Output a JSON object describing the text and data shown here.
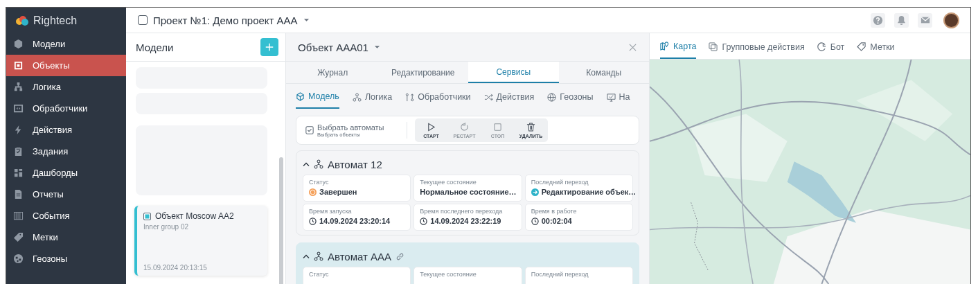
{
  "app": {
    "name": "Rightech"
  },
  "sidebar": {
    "items": [
      {
        "label": "Модели",
        "selected": false
      },
      {
        "label": "Объекты",
        "selected": true
      },
      {
        "label": "Логика",
        "selected": false
      },
      {
        "label": "Обработчики",
        "selected": false
      },
      {
        "label": "Действия",
        "selected": false
      },
      {
        "label": "Задания",
        "selected": false
      },
      {
        "label": "Дашборды",
        "selected": false
      },
      {
        "label": "Отчеты",
        "selected": false
      },
      {
        "label": "События",
        "selected": false
      },
      {
        "label": "Метки",
        "selected": false
      },
      {
        "label": "Геозоны",
        "selected": false
      }
    ]
  },
  "header": {
    "project": "Проект №1: Демо проект AAA"
  },
  "models": {
    "title": "Модели",
    "card": {
      "title": "Объект Moscow AA2",
      "group": "Inner group 02",
      "date": "15.09.2024 20:13:15",
      "selected": true
    }
  },
  "object": {
    "title": "Объект AAA01",
    "tabs": [
      {
        "label": "Журнал",
        "selected": false
      },
      {
        "label": "Редактирование",
        "selected": false
      },
      {
        "label": "Сервисы",
        "selected": true
      },
      {
        "label": "Команды",
        "selected": false
      }
    ],
    "subtabs": [
      {
        "label": "Модель",
        "selected": true
      },
      {
        "label": "Логика",
        "selected": false
      },
      {
        "label": "Обработчики",
        "selected": false
      },
      {
        "label": "Действия",
        "selected": false
      },
      {
        "label": "Геозоны",
        "selected": false
      },
      {
        "label": "На",
        "selected": false
      }
    ],
    "select": {
      "label": "Выбрать автоматы",
      "sublabel": "Выбрать объекты",
      "checked": true
    },
    "actions": [
      {
        "label": "СТАРТ",
        "disabled": false
      },
      {
        "label": "РЕСТАРТ",
        "disabled": true
      },
      {
        "label": "СТОП",
        "disabled": true
      },
      {
        "label": "УДАЛИТЬ",
        "disabled": false
      }
    ],
    "automata": [
      {
        "title": "Автомат 12",
        "expanded": true,
        "highlighted": false,
        "linked": false,
        "fields": [
          {
            "label": "Статус",
            "value": "Завершен",
            "kind": "status",
            "color": "#f5a25d"
          },
          {
            "label": "Текущее состояние",
            "value": "Нормальное состояние…",
            "kind": "text"
          },
          {
            "label": "Последний переход",
            "value": "Редактирование объек…",
            "kind": "transition",
            "color": "#2fb3c9"
          },
          {
            "label": "Время запуска",
            "value": "14.09.2024 23:20:14",
            "kind": "time"
          },
          {
            "label": "Время последнего перехода",
            "value": "14.09.2024 23:22:19",
            "kind": "time"
          },
          {
            "label": "Время в работе",
            "value": "00:02:04",
            "kind": "time"
          }
        ]
      },
      {
        "title": "Автомат AAA",
        "expanded": true,
        "highlighted": true,
        "linked": true,
        "fields": [
          {
            "label": "Статус"
          },
          {
            "label": "Текущее состояние"
          },
          {
            "label": "Последний переход"
          }
        ]
      }
    ]
  },
  "map_panel": {
    "tabs": [
      {
        "label": "Карта",
        "selected": true
      },
      {
        "label": "Групповые действия",
        "selected": false
      },
      {
        "label": "Бот",
        "selected": false
      },
      {
        "label": "Метки",
        "selected": false
      }
    ]
  }
}
